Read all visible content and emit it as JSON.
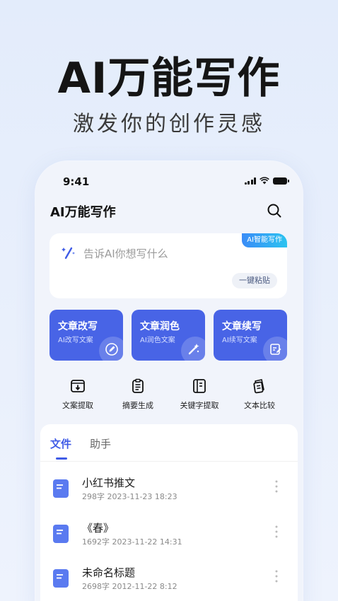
{
  "hero": {
    "title": "AI万能写作",
    "subtitle": "激发你的创作灵感"
  },
  "status_bar": {
    "time": "9:41"
  },
  "app": {
    "title": "AI万能写作"
  },
  "input": {
    "placeholder": "告诉AI你想写什么",
    "badge": "AI智能写作",
    "paste_label": "一键粘贴"
  },
  "tools": [
    {
      "title": "文章改写",
      "desc": "AI改写文案",
      "icon": "pen-icon"
    },
    {
      "title": "文章润色",
      "desc": "AI润色文案",
      "icon": "magic-wand-icon"
    },
    {
      "title": "文章续写",
      "desc": "AI续写文案",
      "icon": "edit-doc-icon"
    }
  ],
  "quick_actions": [
    {
      "label": "文案提取",
      "icon": "download-box-icon"
    },
    {
      "label": "摘要生成",
      "icon": "clipboard-icon"
    },
    {
      "label": "关键字提取",
      "icon": "notebook-icon"
    },
    {
      "label": "文本比较",
      "icon": "compare-doc-icon"
    }
  ],
  "tabs": [
    {
      "label": "文件",
      "active": true
    },
    {
      "label": "助手",
      "active": false
    }
  ],
  "files": [
    {
      "title": "小红书推文",
      "meta": "298字  2023-11-23 18:23"
    },
    {
      "title": "《春》",
      "meta": "1692字  2023-11-22 14:31"
    },
    {
      "title": "未命名标题",
      "meta": "2698字  2012-11-22 8:12"
    }
  ],
  "colors": {
    "accent": "#4864e6",
    "tab_active": "#3f5be6",
    "background": "#e6eefc"
  }
}
